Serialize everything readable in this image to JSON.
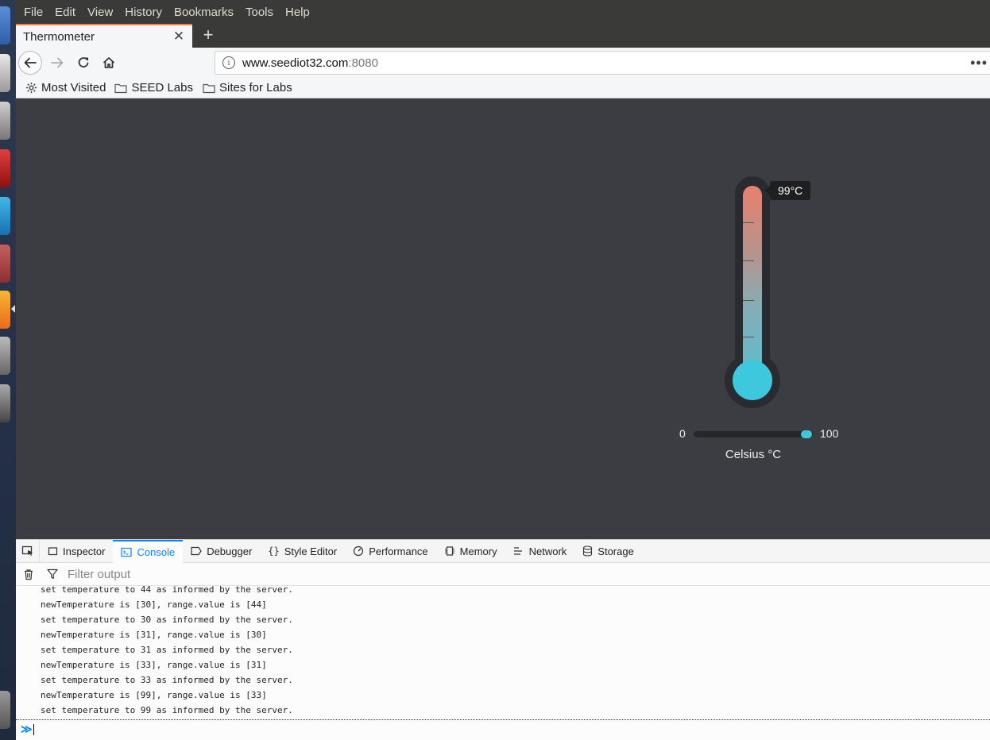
{
  "menubar": {
    "items": [
      "File",
      "Edit",
      "View",
      "History",
      "Bookmarks",
      "Tools",
      "Help"
    ]
  },
  "tab": {
    "title": "Thermometer",
    "close_glyph": "✕",
    "new_tab_glyph": "+"
  },
  "navbar": {
    "url_host": "www.seediot32.com",
    "url_port": ":8080",
    "info_glyph": "i",
    "more_glyph": "•••"
  },
  "bookmarks": {
    "items": [
      "Most Visited",
      "SEED Labs",
      "Sites for Labs"
    ]
  },
  "thermometer": {
    "value": 99,
    "value_label": "99°C",
    "min_label": "0",
    "max_label": "100",
    "min": 0,
    "max": 100,
    "unit_label": "Celsius °C",
    "fill_top_color": "#e8806f",
    "fill_bottom_color": "#3ec8dd"
  },
  "devtools": {
    "tabs": [
      "Inspector",
      "Console",
      "Debugger",
      "Style Editor",
      "Performance",
      "Memory",
      "Network",
      "Storage"
    ],
    "active_tab": "Console",
    "filter_placeholder": "Filter output",
    "console_lines": [
      "set temperature to 44 as informed by the server.",
      "newTemperature is [30], range.value is [44]",
      "set temperature to 30 as informed by the server.",
      "newTemperature is [31], range.value is [30]",
      "set temperature to 31 as informed by the server.",
      "newTemperature is [33], range.value is [31]",
      "set temperature to 33 as informed by the server.",
      "newTemperature is [99], range.value is [33]",
      "set temperature to 99 as informed by the server."
    ],
    "prompt_glyph": "≫"
  }
}
